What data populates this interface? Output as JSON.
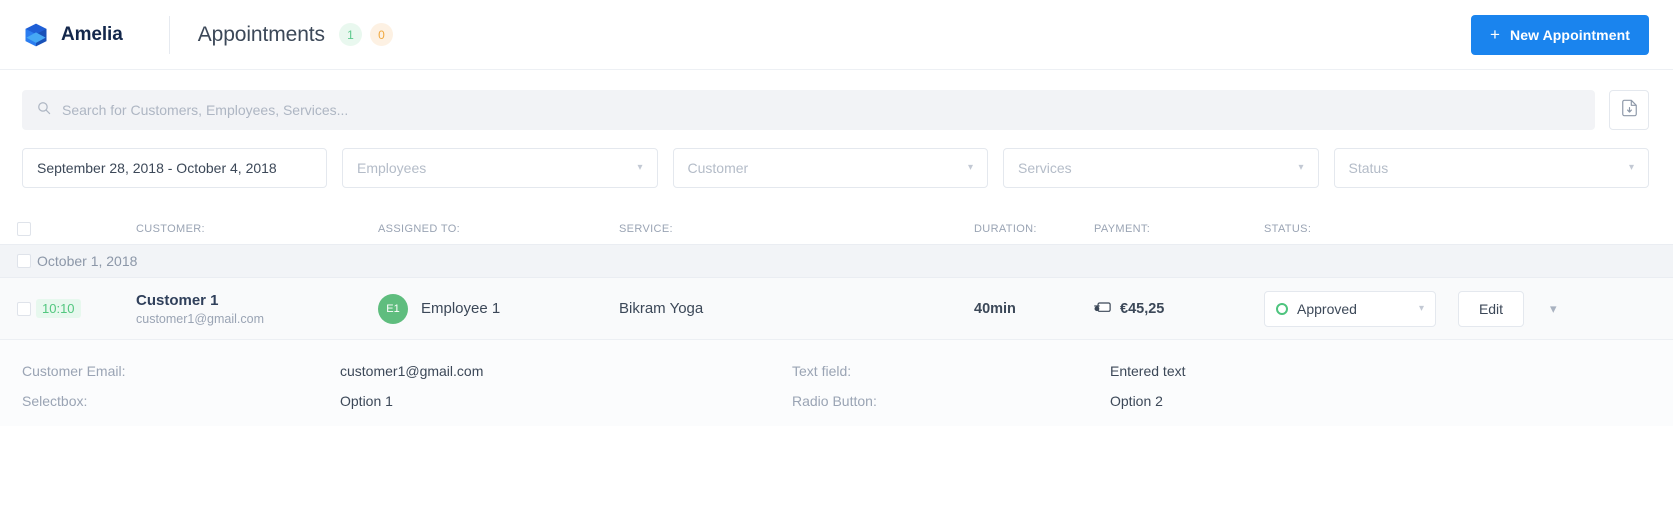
{
  "header": {
    "brand": "Amelia",
    "logo_icon": "amelia-cube-logo",
    "page_title": "Appointments",
    "badge_approved": "1",
    "badge_pending": "0",
    "new_appointment_label": "New Appointment",
    "plus_icon": "plus-icon",
    "accent_color": "#1a84ee",
    "badge_green_color": "#5bc98c",
    "badge_orange_color": "#f0a83f"
  },
  "search": {
    "placeholder": "Search for Customers, Employees, Services...",
    "value": "",
    "icon": "search-icon",
    "export_icon": "export-file-icon"
  },
  "filters": {
    "date_range": "September 28, 2018 - October 4, 2018",
    "employees": "Employees",
    "customer": "Customer",
    "services": "Services",
    "status": "Status",
    "chevron_icon": "chevron-down-icon"
  },
  "table": {
    "columns": {
      "customer": "CUSTOMER:",
      "assigned_to": "ASSIGNED TO:",
      "service": "SERVICE:",
      "duration": "DURATION:",
      "payment": "PAYMENT:",
      "status": "STATUS:"
    },
    "group_date": "October 1, 2018",
    "row": {
      "time": "10:10",
      "customer_name": "Customer 1",
      "customer_email": "customer1@gmail.com",
      "avatar_initials": "E1",
      "employee_name": "Employee 1",
      "service": "Bikram Yoga",
      "duration": "40min",
      "payment": "€45,25",
      "payment_icon": "payment-card-icon",
      "status": "Approved",
      "status_color": "#4ec47e",
      "edit_label": "Edit",
      "collapse_icon": "chevron-down-icon"
    }
  },
  "details": {
    "customer_email_label": "Customer Email:",
    "customer_email_value": "customer1@gmail.com",
    "text_field_label": "Text field:",
    "text_field_value": "Entered text",
    "selectbox_label": "Selectbox:",
    "selectbox_value": "Option 1",
    "radio_label": "Radio Button:",
    "radio_value": "Option 2"
  }
}
